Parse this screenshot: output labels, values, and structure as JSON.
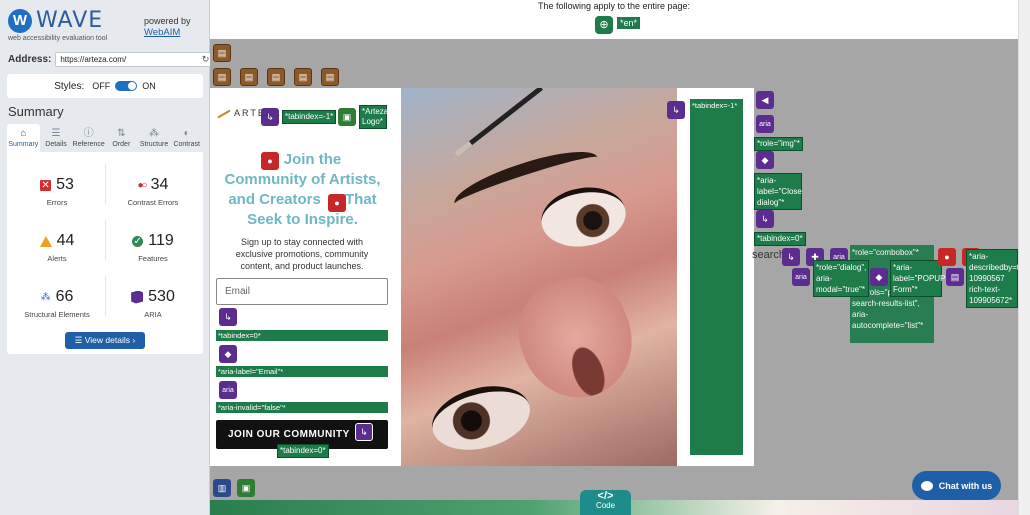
{
  "wave": {
    "logo_mark": "W",
    "logo_word": "WAVE",
    "tagline": "web accessibility evaluation tool",
    "powered_by": "powered by",
    "powered_link": "WebAIM",
    "address_label": "Address:",
    "address_value": "https://arteza.com/",
    "reload_icon": "↻",
    "styles_label": "Styles:",
    "styles_off": "OFF",
    "styles_on": "ON",
    "summary_title": "Summary",
    "tabs": [
      {
        "label": "Summary",
        "icon": "⌂",
        "icon_name": "home-icon"
      },
      {
        "label": "Details",
        "icon": "☰",
        "icon_name": "list-icon"
      },
      {
        "label": "Reference",
        "icon": "ⓘ",
        "icon_name": "info-icon"
      },
      {
        "label": "Order",
        "icon": "⇅",
        "icon_name": "order-icon"
      },
      {
        "label": "Structure",
        "icon": "⁂",
        "icon_name": "structure-icon"
      },
      {
        "label": "Contrast",
        "icon": "◐",
        "icon_name": "contrast-icon"
      }
    ],
    "stats": {
      "errors": {
        "value": "53",
        "label": "Errors"
      },
      "contrast_errors": {
        "value": "34",
        "label": "Contrast Errors"
      },
      "alerts": {
        "value": "44",
        "label": "Alerts"
      },
      "features": {
        "value": "119",
        "label": "Features"
      },
      "structural": {
        "value": "66",
        "label": "Structural Elements"
      },
      "aria": {
        "value": "530",
        "label": "ARIA"
      }
    },
    "view_details": "☰  View details ›"
  },
  "page": {
    "header_note": "The following apply to the entire page:",
    "lang_tag": "*en*",
    "modal": {
      "brand": "ARTEZA",
      "headline_1": "Join the",
      "headline_2": "Community of Artists,",
      "headline_3": "and Creators",
      "headline_4": "That",
      "headline_5": "Seek to Inspire.",
      "subtext": "Sign up to stay connected with exclusive promotions, community content, and product launches.",
      "email_placeholder": "Email",
      "join_button": "JOIN OUR COMMUNITY",
      "tabindex_neg": "*tabindex=-1*",
      "logo_alt": "*Arteza Logo*",
      "tabindex_0": "*tabindex=0*",
      "aria_label_email": "*aria-label=\"Email\"*",
      "aria_invalid": "*aria-invalid=\"false\"*",
      "join_tabindex": "*tabindex=0*",
      "right_col_tag": "*tabindex=-1*"
    },
    "annotations": {
      "role_img": "*role=\"img\"*",
      "aria_label_close": "*aria-label=\"Close dialog\"*",
      "tabindex0": "*tabindex=0*",
      "role_combobox": "*role=\"combobox\"*",
      "role_dialog": "*role=\"dialog\", aria-modal=\"true\"*",
      "aria_label_popup": "*aria-label=\"POPUP Form\"*",
      "aria_controls": "aria-controls=\"predictive-search-results-list\", aria-autocomplete=\"list\"*",
      "aria_describedby": "*aria-describedby=text-10990567 rich-text-109905672*",
      "aria_short": "aria"
    },
    "search_ghost": "search",
    "code_button": "Code",
    "code_glyph": "</>",
    "chat_button": "Chat with us"
  },
  "colors": {
    "wave_blue": "#1f6fc2",
    "annotation_green": "#1e7b4a",
    "aria_purple": "#5b2d8e",
    "error_red": "#d32f2f",
    "headline_teal": "#6fb7c4"
  }
}
